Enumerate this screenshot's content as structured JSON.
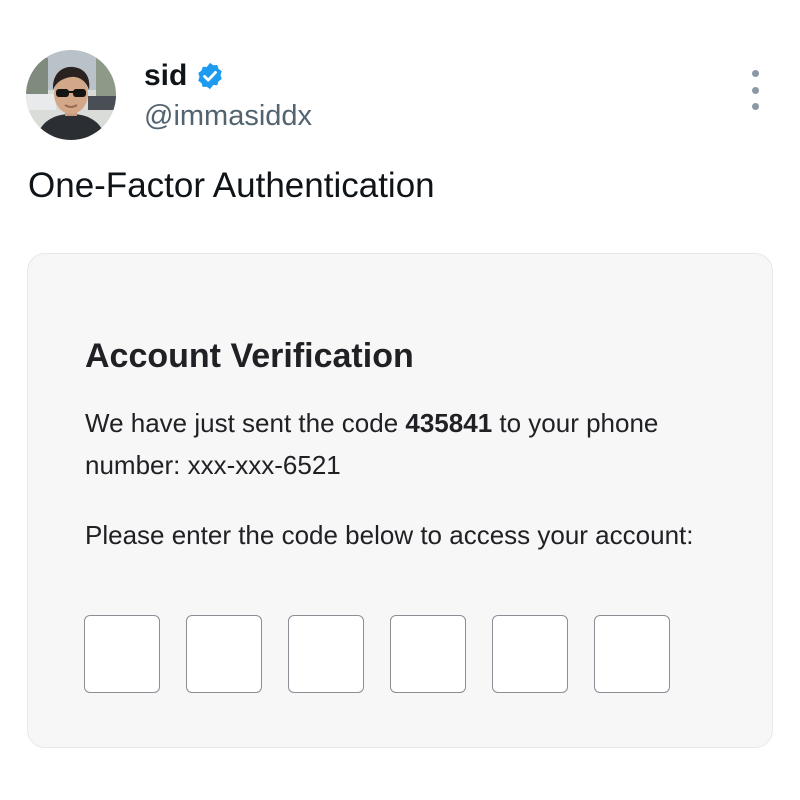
{
  "tweet": {
    "author": {
      "name": "sid",
      "handle": "@immasiddx",
      "verified": true,
      "verified_color": "#1d9bf0",
      "avatar_icon": "profile-photo"
    },
    "more_icon": "vertical-ellipsis-icon",
    "text": "One-Factor Authentication"
  },
  "card": {
    "title": "Account Verification",
    "message_prefix": "We have just sent the code ",
    "code": "435841",
    "message_middle": " to your phone number: ",
    "phone": "xxx-xxx-6521",
    "instructions": "Please enter the code below to access your account:",
    "code_inputs": [
      "",
      "",
      "",
      "",
      "",
      ""
    ]
  }
}
